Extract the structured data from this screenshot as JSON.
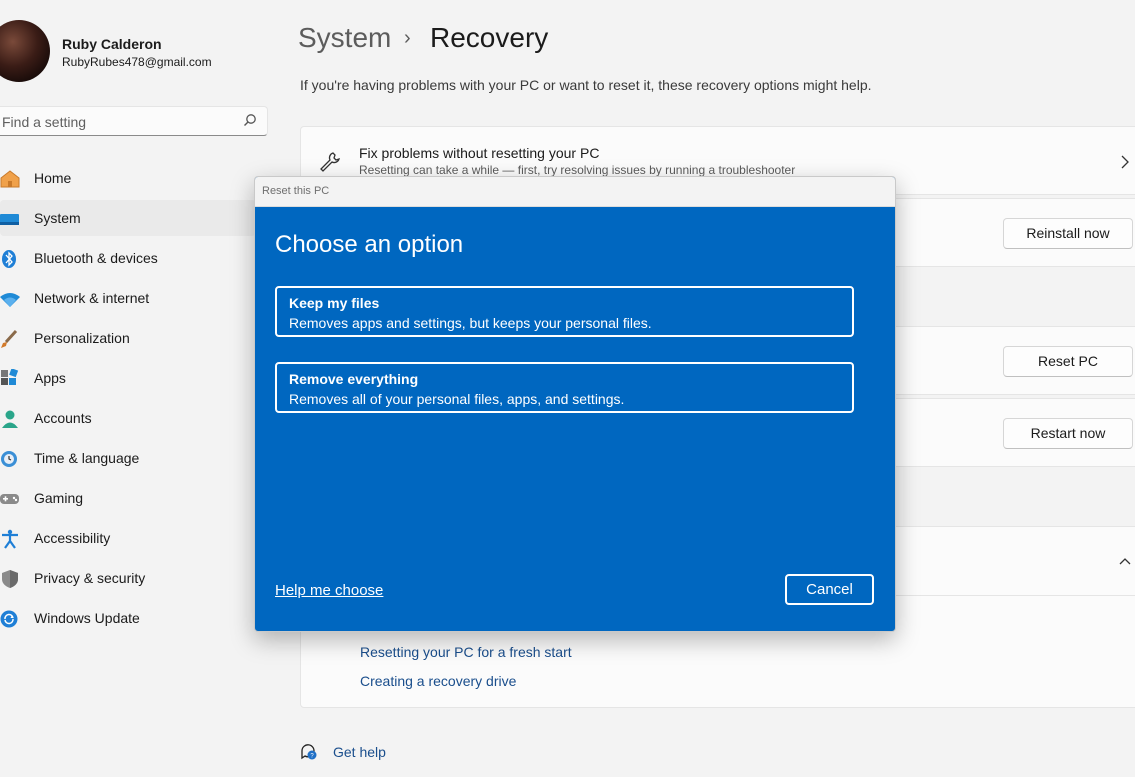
{
  "user": {
    "name": "Ruby Calderon",
    "email": "RubyRubes478@gmail.com"
  },
  "search": {
    "placeholder": "Find a setting"
  },
  "sidebar": {
    "items": [
      {
        "label": "Home",
        "icon": "home-icon"
      },
      {
        "label": "System",
        "icon": "system-icon",
        "selected": true
      },
      {
        "label": "Bluetooth & devices",
        "icon": "bluetooth-icon"
      },
      {
        "label": "Network & internet",
        "icon": "wifi-icon"
      },
      {
        "label": "Personalization",
        "icon": "brush-icon"
      },
      {
        "label": "Apps",
        "icon": "apps-icon"
      },
      {
        "label": "Accounts",
        "icon": "person-icon"
      },
      {
        "label": "Time & language",
        "icon": "globe-clock-icon"
      },
      {
        "label": "Gaming",
        "icon": "gamepad-icon"
      },
      {
        "label": "Accessibility",
        "icon": "accessibility-icon"
      },
      {
        "label": "Privacy & security",
        "icon": "shield-icon"
      },
      {
        "label": "Windows Update",
        "icon": "update-icon"
      }
    ]
  },
  "header": {
    "parent": "System",
    "separator": "›",
    "title": "Recovery"
  },
  "page": {
    "subtitle": "If you're having problems with your PC or want to reset it, these recovery options might help."
  },
  "cards": {
    "fix": {
      "title": "Fix problems without resetting your PC",
      "subtitle": "Resetting can take a while — first, try resolving issues by running a troubleshooter"
    }
  },
  "buttons": {
    "reinstall": "Reinstall now",
    "reset": "Reset PC",
    "restart": "Restart now"
  },
  "related_links": [
    "Resetting your PC for a fresh start",
    "Creating a recovery drive"
  ],
  "get_help": "Get help",
  "dialog": {
    "window_title": "Reset this PC",
    "heading": "Choose an option",
    "options": [
      {
        "title": "Keep my files",
        "description": "Removes apps and settings, but keeps your personal files."
      },
      {
        "title": "Remove everything",
        "description": "Removes all of your personal files, apps, and settings."
      }
    ],
    "help_link": "Help me choose",
    "cancel": "Cancel"
  },
  "colors": {
    "accent": "#0067c0",
    "link": "#1a4e8c",
    "background": "#f3f3f3"
  }
}
